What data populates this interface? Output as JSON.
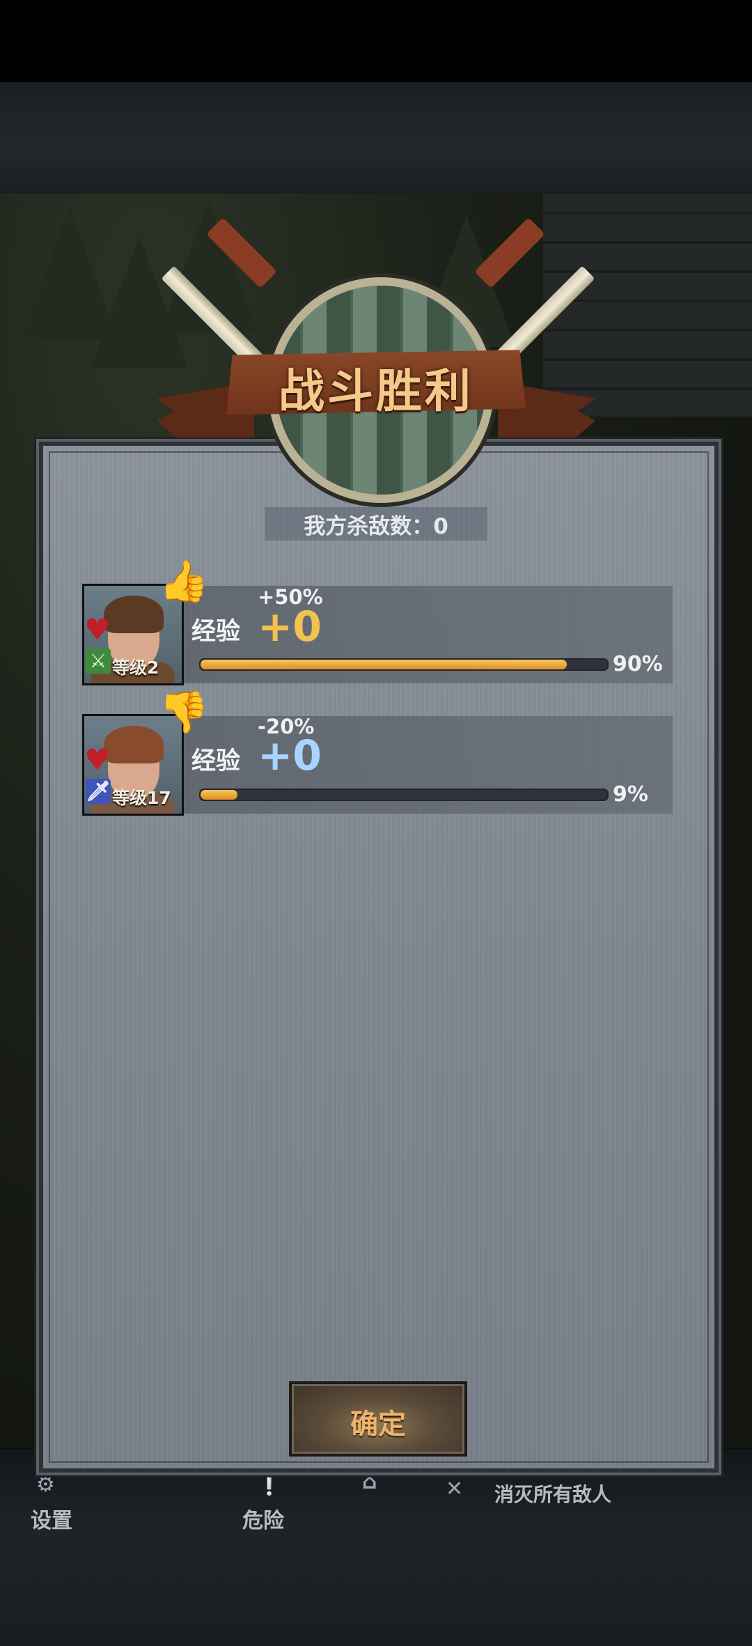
{
  "battle": {
    "title": "战斗胜利",
    "kills_label": "我方杀敌数：0"
  },
  "heroes": [
    {
      "level": "等级2",
      "bonus": "+50%",
      "bonus_type": "thumb-up",
      "exp_label": "经验",
      "exp_gain": "+0",
      "progress": 0.9,
      "progress_text": "90%",
      "class_icon": "crossed-swords-icon"
    },
    {
      "level": "等级17",
      "bonus": "-20%",
      "bonus_type": "thumb-down",
      "exp_label": "经验",
      "exp_gain": "+0",
      "progress": 0.09,
      "progress_text": "9%",
      "class_icon": "dagger-icon"
    }
  ],
  "confirm_button": "确定",
  "bottom_nav": {
    "settings": "设置",
    "danger": "危险",
    "objective": "消灭所有敌人"
  },
  "colors": {
    "exp_gold": "#f2c24f",
    "exp_blue": "#a9d4ff",
    "bar_fill": "#e8a233",
    "button_text": "#f0b36b"
  }
}
